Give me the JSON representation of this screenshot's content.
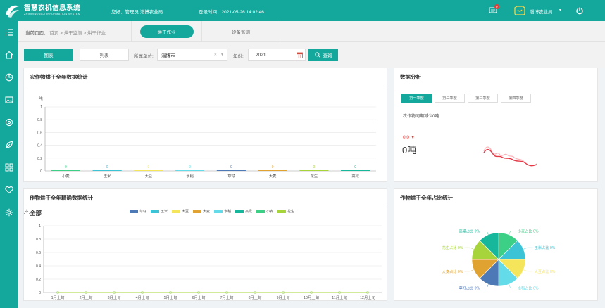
{
  "header": {
    "title": "智慧农机信息系统",
    "subtitle": "ZHIHUINONGJI INFORMATION SYSTEM",
    "greeting": "您好：管理员 淄博农业局",
    "login_time": "登录时间：2021-05-26 14:02:46",
    "message_count": "0",
    "username": "淄博农业局"
  },
  "sidebar": {
    "icons": [
      "menu-icon",
      "home-icon",
      "pie-chart-icon",
      "image-icon",
      "settings-icon",
      "leaf-icon",
      "grid-icon",
      "heart-icon",
      "gear-icon"
    ]
  },
  "breadcrumb": {
    "label": "当前页面：",
    "path": "首页 > 烘干监测 > 烘干作业"
  },
  "tabs": [
    {
      "label": "烘干作业",
      "active": true
    },
    {
      "label": "设备监测",
      "active": false
    }
  ],
  "toolbar": {
    "chart_label": "图表",
    "list_label": "列表",
    "unit_label": "所属单位:",
    "unit_value": "淄博市",
    "year_label": "年份:",
    "year_value": "2021",
    "query_label": "查询"
  },
  "panels": {
    "annual": {
      "title": "农作物烘干全年数据统计"
    },
    "analysis": {
      "title": "数据分析",
      "quarters": [
        "第一季度",
        "第二季度",
        "第三季度",
        "第四季度"
      ],
      "active_quarter": 0,
      "note": "农作物同期减少0吨",
      "change": "0.0 ▼",
      "value": "0吨"
    },
    "precise": {
      "title": "作物烘干全年精确数据统计",
      "all_label": "全部"
    },
    "share": {
      "title": "作物烘干全年占比统计"
    }
  },
  "colors": {
    "brand": "#14a89c",
    "crops": {
      "草籽": "#4e79b7",
      "玉米": "#3cc4d6",
      "大豆": "#f4e55a",
      "大麦": "#e0a331",
      "水稻": "#63dbe8",
      "高粱": "#17b79b",
      "小麦": "#3ccf86",
      "花生": "#a6d43a"
    }
  },
  "chart_data": [
    {
      "type": "bar",
      "ylabel": "吨",
      "categories": [
        "小麦",
        "玉米",
        "大豆",
        "水稻",
        "草籽",
        "大麦",
        "花生",
        "高粱"
      ],
      "values": [
        0,
        0,
        0,
        0,
        0,
        0,
        0,
        0
      ],
      "data_labels": [
        "0",
        "0",
        "0",
        "0",
        "0",
        "0",
        "0",
        "0"
      ],
      "ylim": [
        0,
        1
      ],
      "yticks": [
        "0",
        "0.2",
        "0.4",
        "0.6",
        "0.8",
        "1"
      ],
      "grid": true
    },
    {
      "type": "line",
      "x": [
        "1月上旬",
        "2月上旬",
        "3月上旬",
        "4月上旬",
        "5月上旬",
        "6月上旬",
        "7月上旬",
        "8月上旬",
        "9月上旬",
        "10月上旬",
        "11月上旬",
        "12月上旬"
      ],
      "series": [
        {
          "name": "草籽",
          "values": [
            0,
            0,
            0,
            0,
            0,
            0,
            0,
            0,
            0,
            0,
            0,
            0
          ]
        },
        {
          "name": "玉米",
          "values": [
            0,
            0,
            0,
            0,
            0,
            0,
            0,
            0,
            0,
            0,
            0,
            0
          ]
        },
        {
          "name": "大豆",
          "values": [
            0,
            0,
            0,
            0,
            0,
            0,
            0,
            0,
            0,
            0,
            0,
            0
          ]
        },
        {
          "name": "大麦",
          "values": [
            0,
            0,
            0,
            0,
            0,
            0,
            0,
            0,
            0,
            0,
            0,
            0
          ]
        },
        {
          "name": "水稻",
          "values": [
            0,
            0,
            0,
            0,
            0,
            0,
            0,
            0,
            0,
            0,
            0,
            0
          ]
        },
        {
          "name": "高粱",
          "values": [
            0,
            0,
            0,
            0,
            0,
            0,
            0,
            0,
            0,
            0,
            0,
            0
          ]
        },
        {
          "name": "小麦",
          "values": [
            0,
            0,
            0,
            0,
            0,
            0,
            0,
            0,
            0,
            0,
            0,
            0
          ]
        },
        {
          "name": "花生",
          "values": [
            0,
            0,
            0,
            0,
            0,
            0,
            0,
            0,
            0,
            0,
            0,
            0
          ]
        }
      ],
      "ylim": [
        0,
        1
      ],
      "yticks": [
        "0",
        "0.2",
        "0.4",
        "0.6",
        "0.8",
        "1"
      ],
      "legend": "top-center",
      "grid": true
    },
    {
      "type": "pie",
      "labels": [
        "小麦占比 0%",
        "玉米占比 0%",
        "大豆占比 0%",
        "水稻占比 0%",
        "草籽占比 0%",
        "大麦占比 0%",
        "花生占比 0%",
        "高粱占比 0%"
      ],
      "series_keys": [
        "小麦",
        "玉米",
        "大豆",
        "水稻",
        "草籽",
        "大麦",
        "花生",
        "高粱"
      ],
      "values": [
        0,
        0,
        0,
        0,
        0,
        0,
        0,
        0
      ]
    }
  ]
}
